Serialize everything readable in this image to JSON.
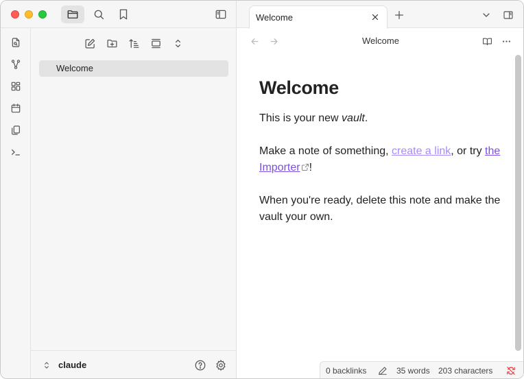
{
  "sidebar": {
    "titlebar_buttons": [
      "folder-icon",
      "search-icon",
      "bookmark-icon",
      "sidebar-toggle-icon"
    ],
    "ribbon": [
      "open-quick-switcher-icon",
      "graph-view-icon",
      "canvas-icon",
      "daily-note-icon",
      "templates-icon",
      "command-palette-icon"
    ],
    "explorer_toolbar": [
      "new-note-icon",
      "new-folder-icon",
      "sort-icon",
      "auto-reveal-icon",
      "collapse-all-icon"
    ],
    "files": [
      {
        "label": "Welcome"
      }
    ],
    "vault": {
      "name": "claude"
    }
  },
  "tabs": [
    {
      "label": "Welcome"
    }
  ],
  "view": {
    "title": "Welcome"
  },
  "note": {
    "heading": "Welcome",
    "p1_before": "This is your new ",
    "p1_italic": "vault",
    "p1_after": ".",
    "p2_before": "Make a note of something, ",
    "p2_link1": "create a link",
    "p2_mid": ", or try ",
    "p2_link2": "the Importer",
    "p2_after": "!",
    "p3": "When you're ready, delete this note and make the vault your own."
  },
  "status": {
    "backlinks": "0 backlinks",
    "words": "35 words",
    "characters": "203 characters"
  },
  "colors": {
    "accent": "#a88bfa",
    "link_external": "#7b4fe0",
    "sync_error": "#e5393f"
  }
}
